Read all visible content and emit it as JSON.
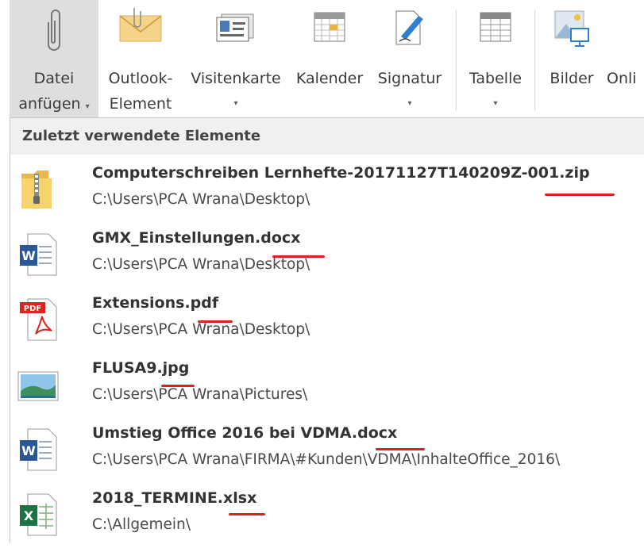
{
  "ribbon": {
    "buttons": [
      {
        "line1": "Datei",
        "line2": "anfügen",
        "icon": "paperclip-icon",
        "has_dropdown": true
      },
      {
        "line1": "Outlook-",
        "line2": "Element",
        "icon": "envelope-icon",
        "has_dropdown": false
      },
      {
        "line1": "Visitenkarte",
        "line2": "",
        "icon": "business-card-icon",
        "has_dropdown": true
      },
      {
        "line1": "Kalender",
        "line2": "",
        "icon": "calendar-icon",
        "has_dropdown": false
      },
      {
        "line1": "Signatur",
        "line2": "",
        "icon": "signature-icon",
        "has_dropdown": true
      },
      {
        "line1": "Tabelle",
        "line2": "",
        "icon": "table-icon",
        "has_dropdown": true
      },
      {
        "line1": "Bilder",
        "line2": "",
        "icon": "pictures-icon",
        "has_dropdown": false
      },
      {
        "line1": "Onli",
        "line2": "",
        "icon": "online-pictures-icon",
        "has_dropdown": false
      }
    ],
    "dropdown_caret": "▾"
  },
  "recent": {
    "header": "Zuletzt verwendete Elemente",
    "items": [
      {
        "name": "Computerschreiben Lernhefte-20171127T140209Z-001.zip",
        "path": "C:\\Users\\PCA Wrana\\Desktop\\",
        "icon": "zip-folder-icon"
      },
      {
        "name": "GMX_Einstellungen.docx",
        "path": "C:\\Users\\PCA Wrana\\Desktop\\",
        "icon": "word-document-icon"
      },
      {
        "name": "Extensions.pdf",
        "path": "C:\\Users\\PCA Wrana\\Desktop\\",
        "icon": "pdf-document-icon"
      },
      {
        "name": "FLUSA9.jpg",
        "path": "C:\\Users\\PCA Wrana\\Pictures\\",
        "icon": "image-file-icon"
      },
      {
        "name": "Umstieg Office 2016 bei VDMA.docx",
        "path": "C:\\Users\\PCA Wrana\\FIRMA\\#Kunden\\VDMA\\InhalteOffice_2016\\",
        "icon": "word-document-icon"
      },
      {
        "name": "2018_TERMINE.xlsx",
        "path": "C:\\Allgemein\\",
        "icon": "excel-workbook-icon"
      }
    ]
  },
  "colors": {
    "annotation_underline": "#e02020",
    "active_button": "#dedede",
    "header_bg": "#f0f0f0"
  }
}
